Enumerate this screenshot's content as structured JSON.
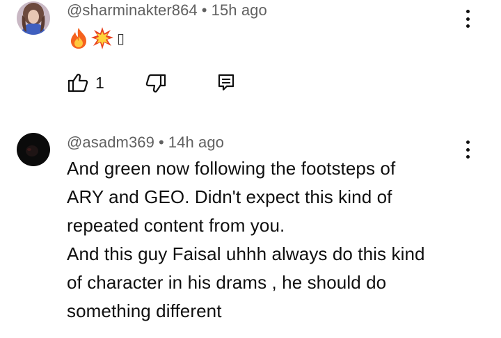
{
  "comments": [
    {
      "handle": "@sharminakter864",
      "separator": "•",
      "time": "15h ago",
      "emoji": [
        "fire-emoji",
        "collision-emoji",
        "unknown-glyph"
      ],
      "unknown_glyph": "▯",
      "likes": "1",
      "icons": {
        "like": "thumb-up-icon",
        "dislike": "thumb-down-icon",
        "reply": "reply-icon",
        "more": "more-vert-icon"
      }
    },
    {
      "handle": "@asadm369",
      "separator": "•",
      "time": "14h ago",
      "text": "And green now following the footsteps of\nARY and GEO. Didn't expect this kind of\nrepeated content from you.\nAnd this guy Faisal uhhh always do this kind\nof character in his drams , he should do\nsomething different",
      "icons": {
        "more": "more-vert-icon"
      }
    }
  ],
  "colors": {
    "text_primary": "#0f0f0f",
    "text_secondary": "#606060",
    "background": "#ffffff"
  }
}
